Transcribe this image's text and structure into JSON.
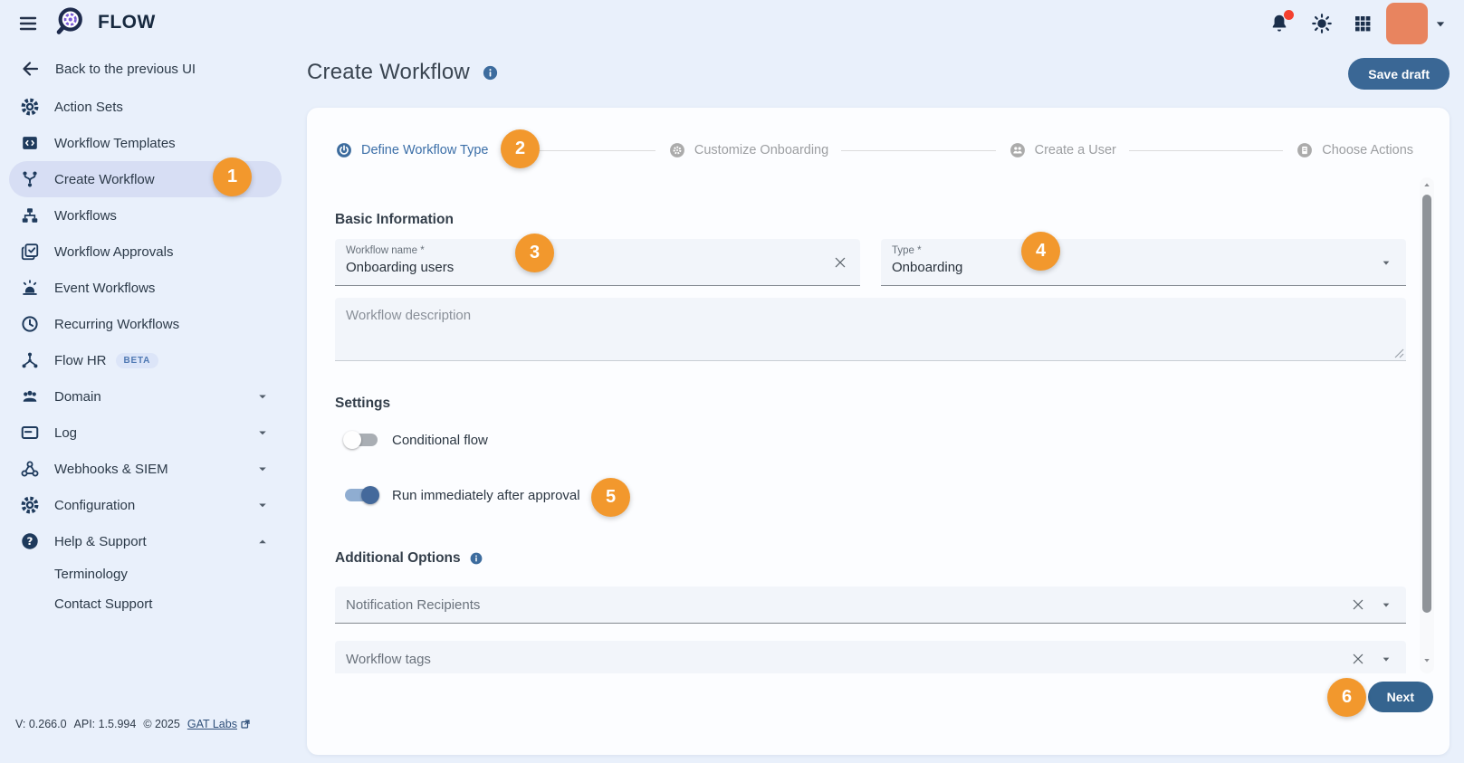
{
  "header": {
    "brand": "FLOW"
  },
  "sidebar": {
    "back_label": "Back to the previous UI",
    "items": [
      {
        "label": "Action Sets",
        "icon": "action-sets"
      },
      {
        "label": "Workflow Templates",
        "icon": "workflow-templates"
      },
      {
        "label": "Create Workflow",
        "icon": "create-workflow",
        "selected": true
      },
      {
        "label": "Workflows",
        "icon": "workflows"
      },
      {
        "label": "Workflow Approvals",
        "icon": "workflow-approvals"
      },
      {
        "label": "Event Workflows",
        "icon": "event-workflows"
      },
      {
        "label": "Recurring Workflows",
        "icon": "recurring-workflows"
      },
      {
        "label": "Flow HR",
        "icon": "flow-hr",
        "badge": "BETA"
      },
      {
        "label": "Domain",
        "icon": "domain",
        "chevron": "down"
      },
      {
        "label": "Log",
        "icon": "log",
        "chevron": "down"
      },
      {
        "label": "Webhooks & SIEM",
        "icon": "webhooks",
        "chevron": "down"
      },
      {
        "label": "Configuration",
        "icon": "configuration",
        "chevron": "down"
      },
      {
        "label": "Help & Support",
        "icon": "help-support",
        "chevron": "up"
      }
    ],
    "sub_items": [
      "Terminology",
      "Contact Support"
    ],
    "footer": {
      "version": "V: 0.266.0",
      "api": "API: 1.5.994",
      "copyright": "© 2025",
      "link_label": "GAT Labs"
    }
  },
  "page": {
    "title": "Create Workflow",
    "save_draft_label": "Save draft",
    "next_label": "Next"
  },
  "stepper": {
    "steps": [
      {
        "label": "Define Workflow Type",
        "state": "active"
      },
      {
        "label": "Customize Onboarding",
        "state": "upcoming"
      },
      {
        "label": "Create a User",
        "state": "upcoming"
      },
      {
        "label": "Choose Actions",
        "state": "upcoming"
      }
    ]
  },
  "form": {
    "basic_information_title": "Basic Information",
    "workflow_name": {
      "label": "Workflow name *",
      "value": "Onboarding users"
    },
    "type": {
      "label": "Type *",
      "value": "Onboarding"
    },
    "description_placeholder": "Workflow description",
    "settings_title": "Settings",
    "toggles": [
      {
        "label": "Conditional flow",
        "on": false
      },
      {
        "label": "Run immediately after approval",
        "on": true
      }
    ],
    "additional_options_title": "Additional Options",
    "notification_recipients_placeholder": "Notification Recipients",
    "workflow_tags_placeholder": "Workflow tags"
  },
  "annotations": [
    "1",
    "2",
    "3",
    "4",
    "5",
    "6"
  ],
  "colors": {
    "accent_blue": "#3d6c9e",
    "annotation_orange": "#f2982d",
    "selected_item_bg": "#d7def4",
    "page_bg": "#e9f0fb",
    "navy_icon": "#1e3a5c"
  }
}
